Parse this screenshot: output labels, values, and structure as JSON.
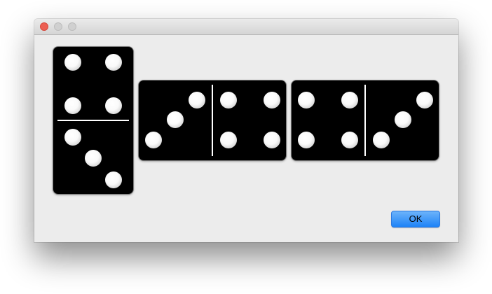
{
  "window": {
    "controls": [
      "close-button",
      "minimize-button",
      "zoom-button"
    ]
  },
  "dominoes": [
    {
      "orientation": "vertical",
      "values": [
        4,
        3
      ]
    },
    {
      "orientation": "horizontal",
      "values": [
        3,
        4
      ]
    },
    {
      "orientation": "horizontal",
      "values": [
        4,
        3
      ]
    }
  ],
  "dialog": {
    "ok_label": "OK"
  },
  "colors": {
    "domino": "#000000",
    "pip": "#ffffff",
    "accent": "#1e83f7",
    "close": "#ec5f52"
  }
}
